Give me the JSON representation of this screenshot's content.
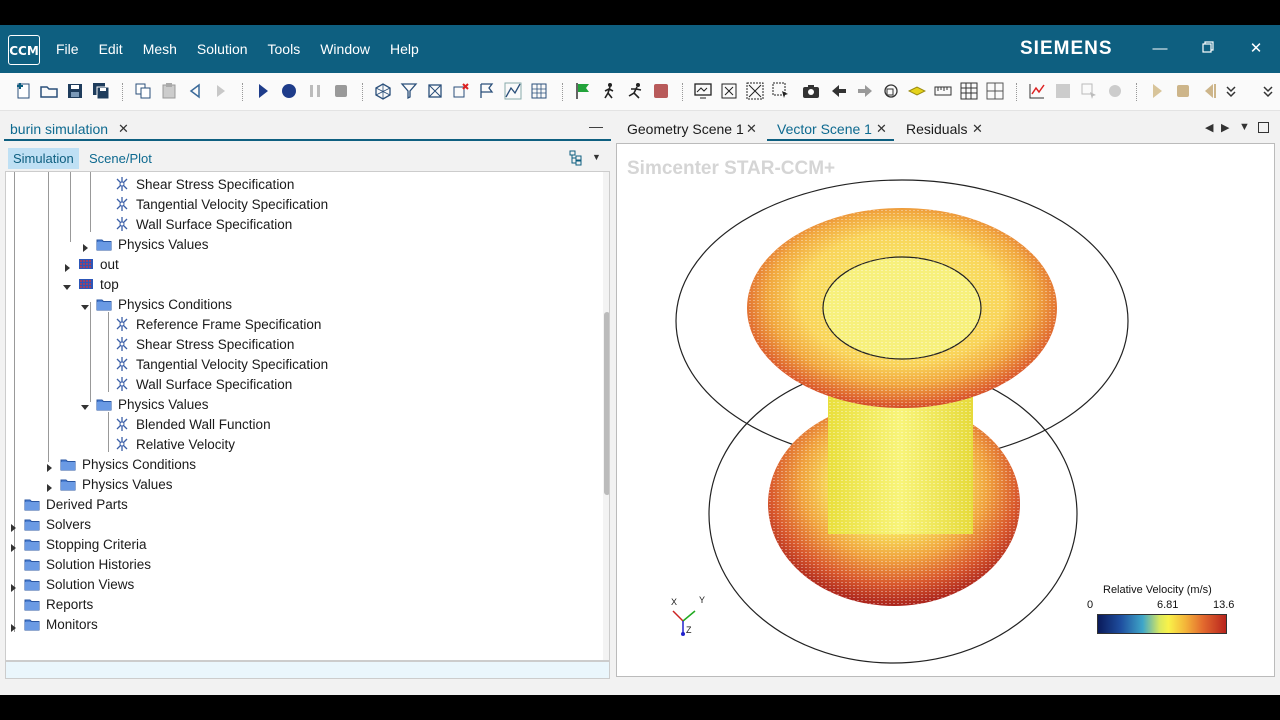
{
  "app": {
    "logo_text": "CCM",
    "brand": "SIEMENS",
    "menu": [
      "File",
      "Edit",
      "Mesh",
      "Solution",
      "Tools",
      "Window",
      "Help"
    ]
  },
  "left_panel": {
    "tab_title": "burin simulation",
    "subtabs": [
      "Simulation",
      "Scene/Plot"
    ],
    "tree": [
      {
        "label": "Shear Stress Specification",
        "kind": "spec"
      },
      {
        "label": "Tangential Velocity Specification",
        "kind": "spec"
      },
      {
        "label": "Wall Surface Specification",
        "kind": "spec"
      },
      {
        "label": "Physics Values",
        "kind": "folder"
      },
      {
        "label": "out",
        "kind": "boundary"
      },
      {
        "label": "top",
        "kind": "boundary"
      },
      {
        "label": "Physics Conditions",
        "kind": "folder"
      },
      {
        "label": "Reference Frame Specification",
        "kind": "spec"
      },
      {
        "label": "Shear Stress Specification",
        "kind": "spec"
      },
      {
        "label": "Tangential Velocity Specification",
        "kind": "spec"
      },
      {
        "label": "Wall Surface Specification",
        "kind": "spec"
      },
      {
        "label": "Physics Values",
        "kind": "folder"
      },
      {
        "label": "Blended Wall Function",
        "kind": "spec"
      },
      {
        "label": "Relative Velocity",
        "kind": "spec"
      },
      {
        "label": "Physics Conditions",
        "kind": "folder"
      },
      {
        "label": "Physics Values",
        "kind": "folder"
      },
      {
        "label": "Derived Parts",
        "kind": "folder"
      },
      {
        "label": "Solvers",
        "kind": "folder"
      },
      {
        "label": "Stopping Criteria",
        "kind": "folder"
      },
      {
        "label": "Solution Histories",
        "kind": "folder"
      },
      {
        "label": "Solution Views",
        "kind": "folder"
      },
      {
        "label": "Reports",
        "kind": "folder"
      },
      {
        "label": "Monitors",
        "kind": "folder"
      }
    ]
  },
  "right_panel": {
    "tabs": [
      "Geometry Scene 1",
      "Vector Scene 1",
      "Residuals"
    ],
    "active_tab": "Vector Scene 1",
    "watermark": "Simcenter STAR-CCM+",
    "legend": {
      "title": "Relative Velocity (m/s)",
      "min": "0",
      "mid": "6.81",
      "max": "13.6"
    },
    "axes": {
      "x": "X",
      "y": "Y",
      "z": "Z"
    }
  },
  "colors": {
    "titlebar": "#0e5f80",
    "accent": "#0e6a90"
  }
}
